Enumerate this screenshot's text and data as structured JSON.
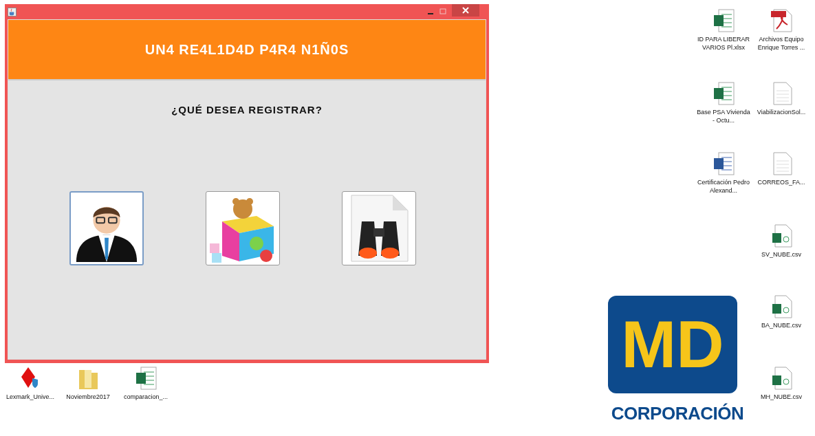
{
  "window": {
    "header": "UN4 RE4L1D4D P4R4 N1Ñ0S",
    "question": "¿QUÉ DESEA REGISTRAR?",
    "buttons": [
      {
        "kind": "person",
        "selected": true
      },
      {
        "kind": "toys",
        "selected": false
      },
      {
        "kind": "search",
        "selected": false
      }
    ]
  },
  "left_desktop_icons": [
    {
      "kind": "installer",
      "label": "Lexmark_Unive..."
    },
    {
      "kind": "folder",
      "label": "Noviembre2017"
    },
    {
      "kind": "excel",
      "label": "comparacion_..."
    }
  ],
  "right_desktop_icons": [
    {
      "kind": "excel",
      "label": "ID PARA LIBERAR VARIOS Pl.xlsx"
    },
    {
      "kind": "pdf",
      "label": "Archivos Equipo Enrique Torres ..."
    },
    {
      "kind": "excel",
      "label": "Base PSA Vivienda - Octu..."
    },
    {
      "kind": "text",
      "label": "ViabilizacionSol..."
    },
    {
      "kind": "word",
      "label": "Certificación Pedro Alexand..."
    },
    {
      "kind": "text",
      "label": "CORREOS_FA..."
    },
    {
      "kind": "csv",
      "label": "SV_NUBE.csv"
    },
    {
      "kind": "csv",
      "label": "BA_NUBE.csv"
    },
    {
      "kind": "csv",
      "label": "MH_NUBE.csv"
    }
  ],
  "logo": {
    "mark": "MD",
    "name": "CORPORACIÓN"
  }
}
